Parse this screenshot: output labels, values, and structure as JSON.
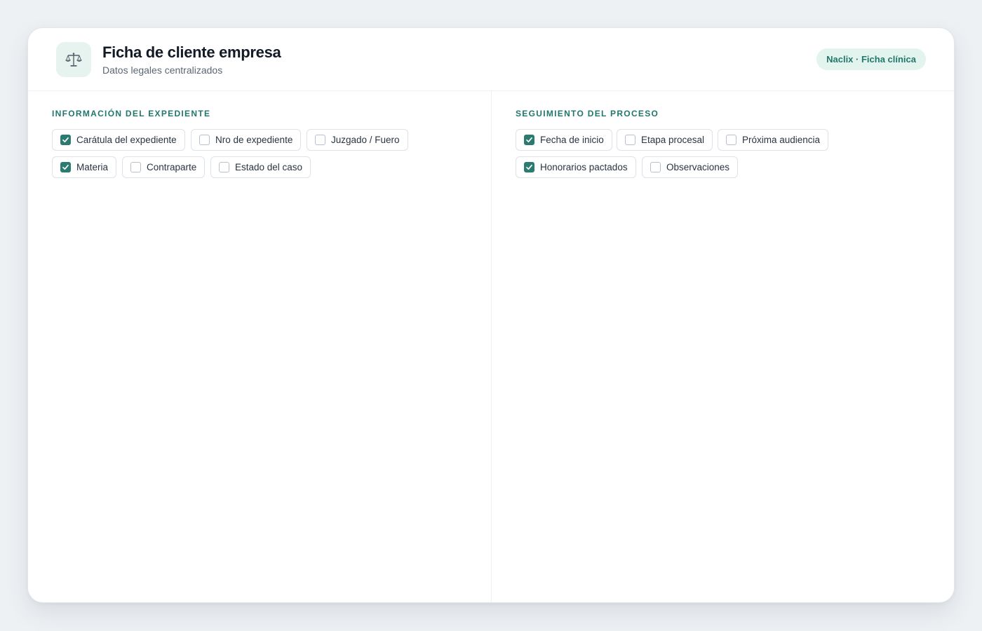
{
  "header": {
    "title": "Ficha de cliente empresa",
    "subtitle": "Datos legales centralizados",
    "badge": "Naclix · Ficha clínica",
    "logo_icon": "scales-icon"
  },
  "colors": {
    "accent": "#2c7a70",
    "section_title": "#21776b",
    "badge_bg": "#e3f3ee",
    "logo_bg": "#e6f3ef"
  },
  "sections": [
    {
      "title": "INFORMACIÓN DEL EXPEDIENTE",
      "fields": [
        {
          "label": "Carátula del expediente",
          "checked": true
        },
        {
          "label": "Nro de expediente",
          "checked": false
        },
        {
          "label": "Juzgado / Fuero",
          "checked": false
        },
        {
          "label": "Materia",
          "checked": true
        },
        {
          "label": "Contraparte",
          "checked": false
        },
        {
          "label": "Estado del caso",
          "checked": false
        }
      ]
    },
    {
      "title": "SEGUIMIENTO DEL PROCESO",
      "fields": [
        {
          "label": "Fecha de inicio",
          "checked": true
        },
        {
          "label": "Etapa procesal",
          "checked": false
        },
        {
          "label": "Próxima audiencia",
          "checked": false
        },
        {
          "label": "Honorarios pactados",
          "checked": true
        },
        {
          "label": "Observaciones",
          "checked": false
        }
      ]
    }
  ]
}
